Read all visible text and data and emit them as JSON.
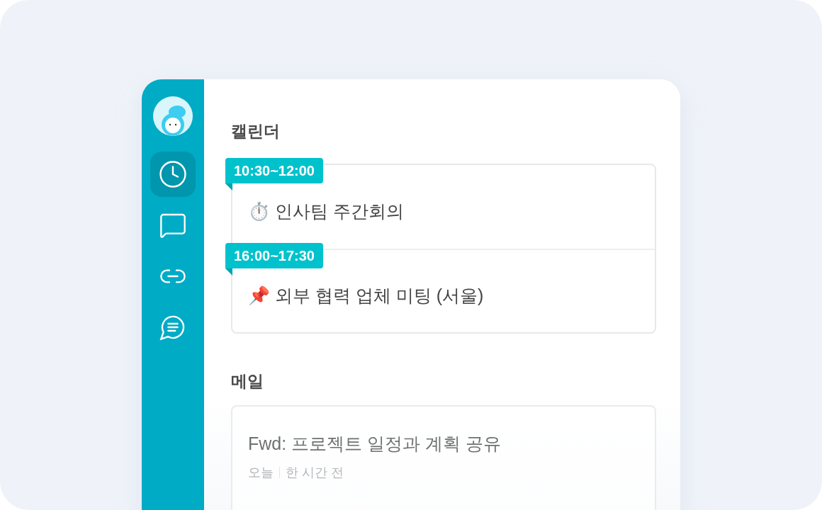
{
  "sidebar": {
    "items": [
      {
        "kind": "clock",
        "selected": true
      },
      {
        "kind": "chat",
        "selected": false
      },
      {
        "kind": "link",
        "selected": false
      },
      {
        "kind": "message",
        "selected": false
      }
    ]
  },
  "calendar": {
    "title": "캘린더",
    "events": [
      {
        "time": "10:30~12:00",
        "icon": "⏱️",
        "title": "인사팀 주간회의"
      },
      {
        "time": "16:00~17:30",
        "icon": "📌",
        "title": "외부 협력 업체 미팅 (서울)"
      }
    ]
  },
  "mail": {
    "title": "메일",
    "items": [
      {
        "subject": "Fwd: 프로젝트 일정과 계획 공유",
        "date": "오늘",
        "ago": "한 시간 전"
      }
    ]
  }
}
